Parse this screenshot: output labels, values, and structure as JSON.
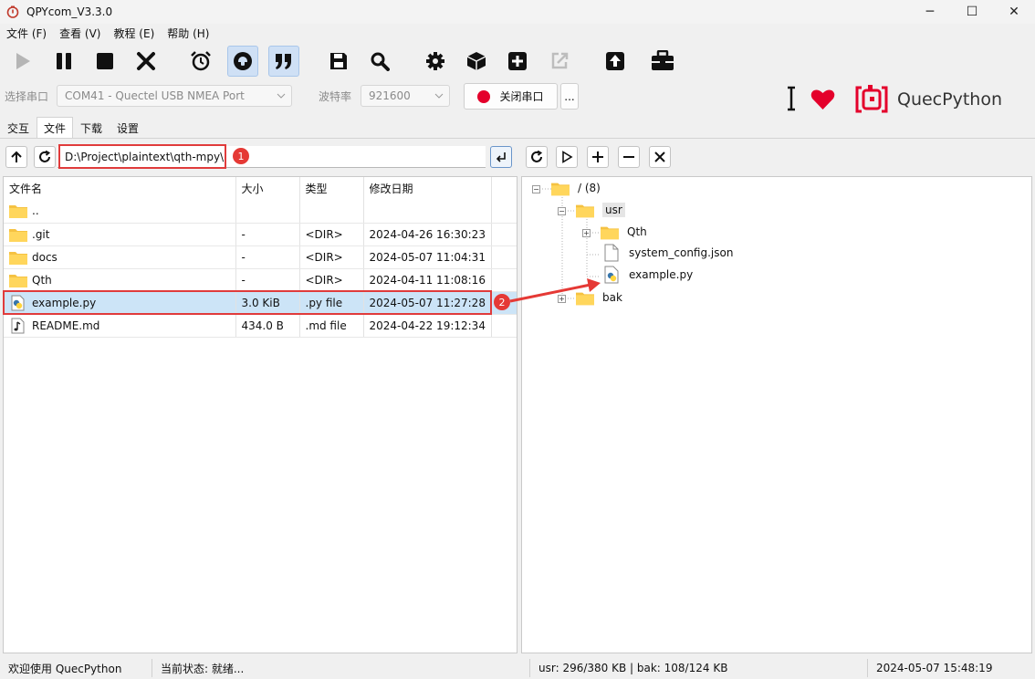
{
  "window": {
    "title": "QPYcom_V3.3.0",
    "minimize": "─",
    "maximize": "☐",
    "close": "✕"
  },
  "menu": [
    "文件 (F)",
    "查看 (V)",
    "教程 (E)",
    "帮助 (H)"
  ],
  "toolbar": {
    "icons": [
      "play-icon",
      "pause-icon",
      "stop-icon",
      "close-x-icon",
      "alarm-clock-icon",
      "headset-icon",
      "quote-icon",
      "save-icon",
      "search-icon",
      "settings-gear-icon",
      "box-icon",
      "add-plus-icon",
      "external-share-icon",
      "upload-icon",
      "toolbox-icon"
    ]
  },
  "connection": {
    "port_label": "选择串口",
    "port_value": "COM41 - Quectel USB NMEA Port",
    "baud_label": "波特率",
    "baud_value": "921600",
    "close_port_label": "关闭串口",
    "more_label": "...",
    "brand": "QuecPython",
    "accent": "#e4002b"
  },
  "tabs": [
    "交互",
    "文件",
    "下载",
    "设置"
  ],
  "local": {
    "path": "D:\\Project\\plaintext\\qth-mpy\\",
    "columns": [
      "文件名",
      "大小",
      "类型",
      "修改日期"
    ],
    "rows": [
      {
        "icon": "folder",
        "name": "..",
        "size": "",
        "type": "",
        "date": ""
      },
      {
        "icon": "folder",
        "name": ".git",
        "size": "-",
        "type": "<DIR>",
        "date": "2024-04-26 16:30:23"
      },
      {
        "icon": "folder",
        "name": "docs",
        "size": "-",
        "type": "<DIR>",
        "date": "2024-05-07 11:04:31"
      },
      {
        "icon": "folder",
        "name": "Qth",
        "size": "-",
        "type": "<DIR>",
        "date": "2024-04-11 11:08:16"
      },
      {
        "icon": "python-file",
        "name": "example.py",
        "size": "3.0 KiB",
        "type": ".py file",
        "date": "2024-05-07 11:27:28",
        "selected": true
      },
      {
        "icon": "music-file",
        "name": "README.md",
        "size": "434.0 B",
        "type": ".md file",
        "date": "2024-04-22 19:12:34"
      }
    ]
  },
  "remote": {
    "root": "/ (8)",
    "usr": "usr",
    "qth": "Qth",
    "config": "system_config.json",
    "example": "example.py",
    "bak": "bak"
  },
  "annotations": {
    "badge1": "1",
    "badge2": "2"
  },
  "status": {
    "welcome": "欢迎使用 QuecPython",
    "state": "当前状态: 就绪...",
    "storage": "usr: 296/380 KB | bak: 108/124 KB",
    "time": "2024-05-07 15:48:19"
  }
}
